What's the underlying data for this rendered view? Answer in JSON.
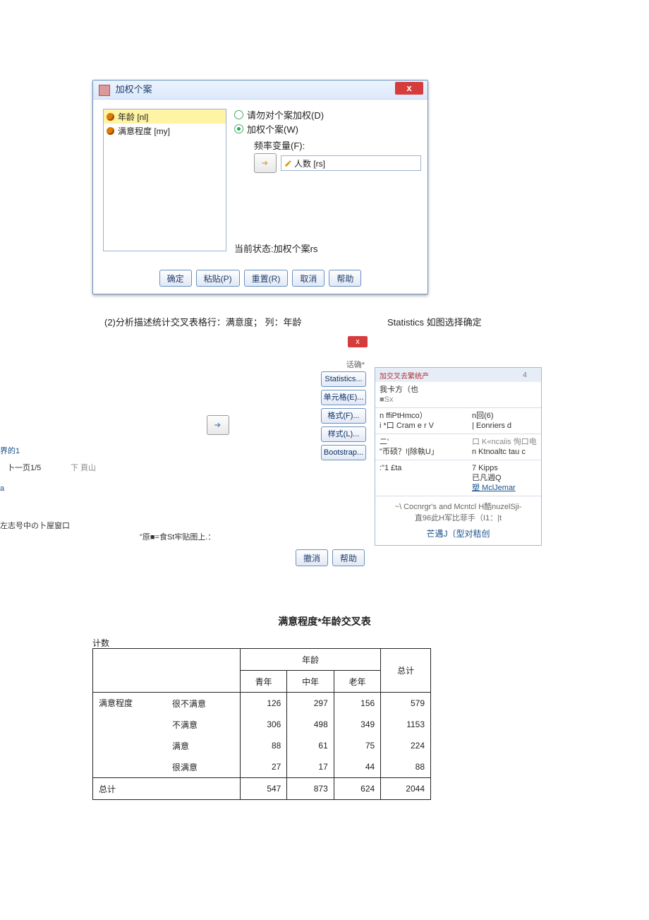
{
  "dlg1": {
    "title": "加权个案",
    "close": "x",
    "vars": [
      "年龄 [nl]",
      "满意程度 [my]"
    ],
    "opt_none": "请勿对个案加权(D)",
    "opt_weight": "加权个案(W)",
    "freq_label": "频率变量(F):",
    "freq_val": "人数 [rs]",
    "status": "当前状态:加权个案rs",
    "btns": {
      "ok": "确定",
      "paste": "粘贴(P)",
      "reset": "重置(R)",
      "cancel": "取消",
      "help": "帮助"
    }
  },
  "txt1": "(2)分析描述统计交叉表格行：满意度； 列：年龄",
  "txt2": "Statistics 如图选择确定",
  "dlg2": {
    "noisy1": "话确* ",
    "side": [
      "Statistics...",
      "单元格(E)...",
      "格式(F)...",
      "样式(L)...",
      "Bootstrap..."
    ],
    "noisy2": "\"原■=食St牢贴图上.：",
    "cancel": "撤消",
    "help": "帮助"
  },
  "panel3": {
    "h1": "加交叉去繁统产",
    "h2": "4",
    "r1l": "我卡方（也",
    "r1l2": "■Sx",
    "r2l": "n ffiPtHmco）",
    "r2l2": "i *口 Cram e r V",
    "r2r": "n回(6)",
    "r2r2": "| Eonriers d",
    "r3l": "二'",
    "r3l2": "\"币硕？!|除執U」",
    "r3r": "口 K«ncaiis 恂口电",
    "r3r2": "n Ktnoaltc tau c",
    "r4l": ":\"1 £ta",
    "r4r": "7 Kipps",
    "r4r2": "已凡週Q",
    "r4r3": "塑 MclJemar",
    "f1": "~\\ Cocnrgr's and Mcntcl H酷nuzelSji-",
    "f2": "直96此H军比菲手（I1：|t",
    "f3": "芒遇J〔型对秸创"
  },
  "frag": {
    "a": "界的1",
    "b": "卜一页1/5",
    "c": "下 頁山",
    "d": "a",
    "e": "左志号中の卜屋窗口"
  },
  "chart_data": {
    "type": "table",
    "title": "满意程度*年龄交叉表",
    "count_label": "计数",
    "col_group": "年龄",
    "cols": [
      "青年",
      "中年",
      "老年",
      "总计"
    ],
    "row_label": "满意程度",
    "rows": [
      {
        "name": "很不满意",
        "v": [
          126,
          297,
          156,
          579
        ]
      },
      {
        "name": "不满意",
        "v": [
          306,
          498,
          349,
          1153
        ]
      },
      {
        "name": "满意",
        "v": [
          88,
          61,
          75,
          224
        ]
      },
      {
        "name": "很满意",
        "v": [
          27,
          17,
          44,
          88
        ]
      }
    ],
    "total_label": "总计",
    "total": [
      547,
      873,
      624,
      2044
    ]
  }
}
